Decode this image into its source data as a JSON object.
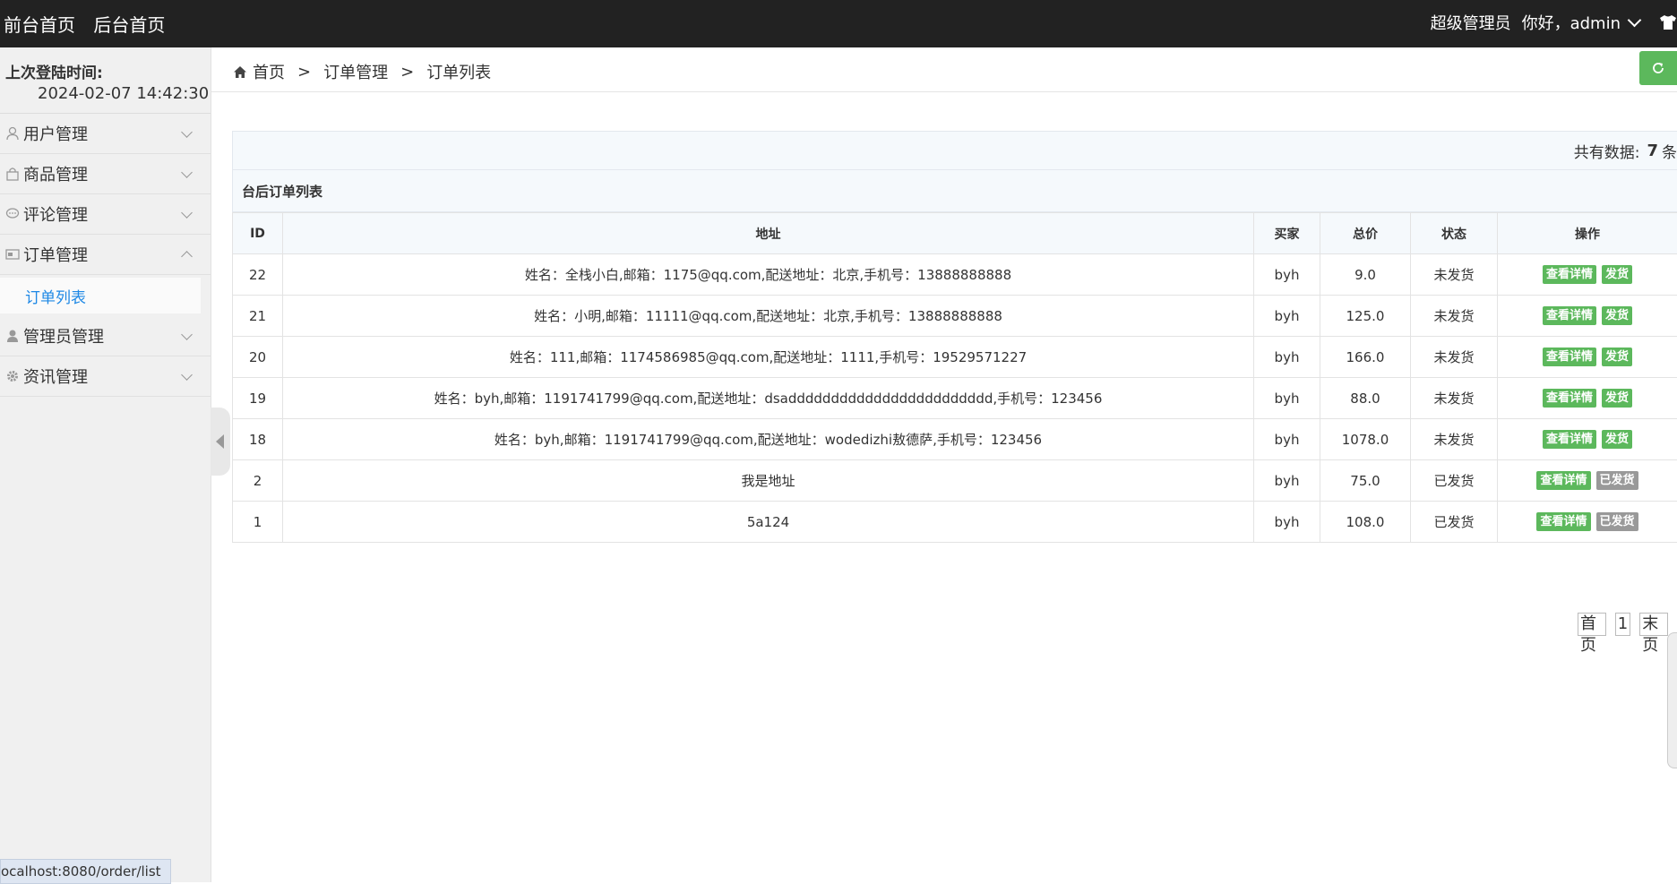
{
  "topbar": {
    "front_home": "前台首页",
    "back_home": "后台首页",
    "role": "超级管理员",
    "greeting": "你好，admin"
  },
  "sidebar": {
    "login_label": "上次登陆时间:",
    "login_time": "2024-02-07 14:42:30",
    "items": [
      {
        "label": "用户管理",
        "icon": "user-icon"
      },
      {
        "label": "商品管理",
        "icon": "bag-icon"
      },
      {
        "label": "评论管理",
        "icon": "comment-icon"
      },
      {
        "label": "订单管理",
        "icon": "order-icon",
        "expanded": true
      },
      {
        "label": "管理员管理",
        "icon": "admin-icon"
      },
      {
        "label": "资讯管理",
        "icon": "gear-icon"
      }
    ],
    "submenu_active": "订单列表"
  },
  "breadcrumb": {
    "home": "首页",
    "sep": ">",
    "level1": "订单管理",
    "level2": "订单列表"
  },
  "summary": {
    "prefix": "共有数据:",
    "count": "7",
    "suffix": "条"
  },
  "table": {
    "title": "台后订单列表",
    "columns": [
      "ID",
      "地址",
      "买家",
      "总价",
      "状态",
      "操作"
    ],
    "detail_label": "查看详情",
    "rows": [
      {
        "id": "22",
        "address": "姓名：全栈小白,邮箱：1175@qq.com,配送地址：北京,手机号：13888888888",
        "buyer": "byh",
        "total": "9.0",
        "status": "未发货",
        "action": "发货",
        "shipped": false
      },
      {
        "id": "21",
        "address": "姓名：小明,邮箱：11111@qq.com,配送地址：北京,手机号：13888888888",
        "buyer": "byh",
        "total": "125.0",
        "status": "未发货",
        "action": "发货",
        "shipped": false
      },
      {
        "id": "20",
        "address": "姓名：111,邮箱：1174586985@qq.com,配送地址：1111,手机号：19529571227",
        "buyer": "byh",
        "total": "166.0",
        "status": "未发货",
        "action": "发货",
        "shipped": false
      },
      {
        "id": "19",
        "address": "姓名：byh,邮箱：1191741799@qq.com,配送地址：dsadddddddddddddddddddddddd,手机号：123456",
        "buyer": "byh",
        "total": "88.0",
        "status": "未发货",
        "action": "发货",
        "shipped": false
      },
      {
        "id": "18",
        "address": "姓名：byh,邮箱：1191741799@qq.com,配送地址：wodedizhi敖德萨,手机号：123456",
        "buyer": "byh",
        "total": "1078.0",
        "status": "未发货",
        "action": "发货",
        "shipped": false
      },
      {
        "id": "2",
        "address": "我是地址",
        "buyer": "byh",
        "total": "75.0",
        "status": "已发货",
        "action": "已发货",
        "shipped": true
      },
      {
        "id": "1",
        "address": "5a124",
        "buyer": "byh",
        "total": "108.0",
        "status": "已发货",
        "action": "已发货",
        "shipped": true
      }
    ]
  },
  "pager": {
    "first": "首页",
    "current": "1",
    "last": "末页"
  },
  "status_bar_url": "ocalhost:8080/order/list",
  "colors": {
    "topbar": "#222222",
    "accent_green": "#5cb85c",
    "link_blue": "#1e88e5",
    "shipped_gray": "#999999"
  }
}
